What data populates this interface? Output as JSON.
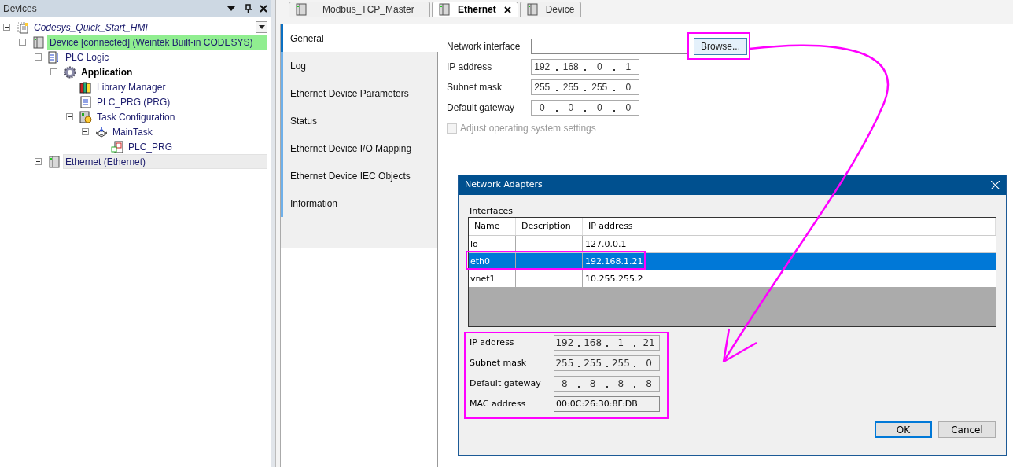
{
  "devices_panel": {
    "title": "Devices",
    "tree": [
      {
        "label": "Codesys_Quick_Start_HMI",
        "kind": "project",
        "expanded": true,
        "selected": false,
        "connected": false,
        "active": false,
        "children": [
          {
            "label": "Device [connected] (Weintek Built-in CODESYS)",
            "kind": "device",
            "expanded": true,
            "selected": false,
            "connected": true,
            "active": false,
            "children": [
              {
                "label": "PLC Logic",
                "kind": "plc-logic",
                "expanded": true,
                "selected": false,
                "connected": false,
                "active": false,
                "children": [
                  {
                    "label": "Application",
                    "kind": "application",
                    "expanded": true,
                    "selected": false,
                    "connected": false,
                    "active": true,
                    "children": [
                      {
                        "label": "Library Manager",
                        "kind": "library",
                        "selected": false,
                        "connected": false,
                        "active": false
                      },
                      {
                        "label": "PLC_PRG (PRG)",
                        "kind": "pou",
                        "selected": false,
                        "connected": false,
                        "active": false
                      },
                      {
                        "label": "Task Configuration",
                        "kind": "task-config",
                        "expanded": true,
                        "selected": false,
                        "connected": false,
                        "active": false,
                        "children": [
                          {
                            "label": "MainTask",
                            "kind": "task",
                            "expanded": true,
                            "selected": false,
                            "connected": false,
                            "active": false,
                            "children": [
                              {
                                "label": "PLC_PRG",
                                "kind": "program-call",
                                "selected": false,
                                "connected": false,
                                "active": false
                              }
                            ]
                          }
                        ]
                      }
                    ]
                  }
                ]
              },
              {
                "label": "Ethernet (Ethernet)",
                "kind": "device",
                "expanded": true,
                "selected": true,
                "connected": false,
                "active": false
              }
            ]
          }
        ]
      }
    ]
  },
  "editor_tabs": [
    {
      "label": "Modbus_TCP_Master",
      "selected": false
    },
    {
      "label": "Ethernet",
      "selected": true
    },
    {
      "label": "Device",
      "selected": false
    }
  ],
  "nav": [
    {
      "label": "General",
      "selected": true
    },
    {
      "label": "Log",
      "selected": false
    },
    {
      "label": "Ethernet Device Parameters",
      "selected": false
    },
    {
      "label": "Status",
      "selected": false
    },
    {
      "label": "Ethernet Device I/O Mapping",
      "selected": false
    },
    {
      "label": "Ethernet Device IEC Objects",
      "selected": false
    },
    {
      "label": "Information",
      "selected": false
    }
  ],
  "general": {
    "network_interface": {
      "label": "Network interface",
      "button": "Browse..."
    },
    "fields": [
      {
        "label": "IP address",
        "octets": [
          "192",
          "168",
          "0",
          "1"
        ]
      },
      {
        "label": "Subnet mask",
        "octets": [
          "255",
          "255",
          "255",
          "0"
        ]
      },
      {
        "label": "Default gateway",
        "octets": [
          "0",
          "0",
          "0",
          "0"
        ]
      }
    ],
    "adjust_os": {
      "label": "Adjust operating system settings",
      "checked": false,
      "disabled": true
    }
  },
  "dialog": {
    "title": "Network Adapters",
    "group_label": "Interfaces",
    "columns": [
      "Name",
      "Description",
      "IP address"
    ],
    "rows": [
      {
        "name": "lo",
        "ip_address": "127.0.0.1",
        "selected": false
      },
      {
        "name": "eth0",
        "ip_address": "192.168.1.21",
        "selected": true
      },
      {
        "name": "vnet1",
        "ip_address": "10.255.255.2",
        "selected": false
      }
    ],
    "details": [
      {
        "label": "IP address",
        "kind": "ip",
        "octets": [
          "192",
          "168",
          "1",
          "21"
        ]
      },
      {
        "label": "Subnet mask",
        "kind": "ip",
        "octets": [
          "255",
          "255",
          "255",
          "0"
        ]
      },
      {
        "label": "Default gateway",
        "kind": "ip",
        "octets": [
          "8",
          "8",
          "8",
          "8"
        ]
      },
      {
        "label": "MAC address",
        "kind": "text",
        "value": "00:0C:26:30:8F:DB"
      }
    ],
    "buttons": [
      {
        "label": "OK",
        "default": true
      },
      {
        "label": "Cancel",
        "default": false
      }
    ]
  }
}
